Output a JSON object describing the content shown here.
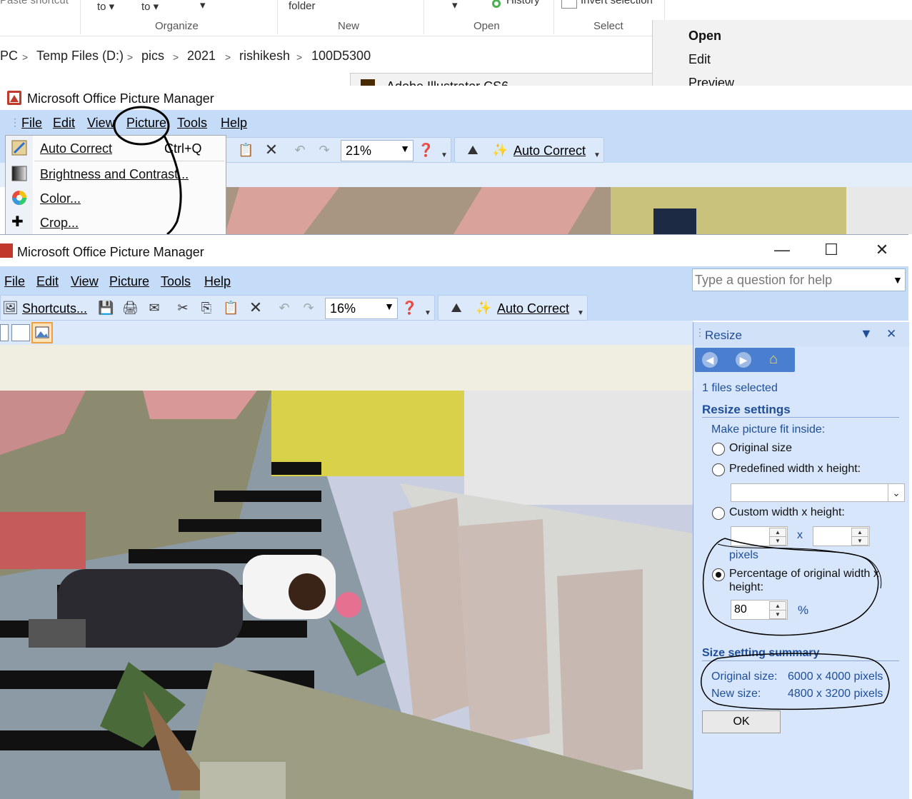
{
  "explorer": {
    "paste_shortcut": "Paste shortcut",
    "move_to": "to",
    "copy_to": "to",
    "folder": "folder",
    "history": "History",
    "invert_selection": "Invert selection",
    "groups": [
      "Organize",
      "New",
      "Open",
      "Select"
    ],
    "breadcrumb": [
      "PC",
      "Temp Files (D:)",
      "pics",
      "2021",
      "rishikesh",
      "100D5300"
    ],
    "illustrator_text": "Adobe Illustrator CS6"
  },
  "context_menu": {
    "items": [
      "Open",
      "Edit",
      "Preview"
    ]
  },
  "back_window": {
    "title": "Microsoft Office Picture Manager",
    "menu": [
      "File",
      "Edit",
      "View",
      "Picture",
      "Tools",
      "Help"
    ],
    "zoom": "21%",
    "auto_correct": "Auto Correct",
    "picture_menu": [
      {
        "label": "Auto Correct",
        "shortcut": "Ctrl+Q"
      },
      {
        "label": "Brightness and Contrast...",
        "shortcut": ""
      },
      {
        "label": "Color...",
        "shortcut": ""
      },
      {
        "label": "Crop...",
        "shortcut": ""
      }
    ]
  },
  "front_window": {
    "title": "Microsoft Office Picture Manager",
    "menu": [
      "File",
      "Edit",
      "View",
      "Picture",
      "Tools",
      "Help"
    ],
    "help_placeholder": "Type a question for help",
    "shortcuts": "Shortcuts...",
    "zoom": "16%",
    "auto_correct": "Auto Correct"
  },
  "resize_pane": {
    "title": "Resize",
    "files_selected": "1 files selected",
    "settings_heading": "Resize settings",
    "fit_inside": "Make picture fit inside:",
    "option_original": "Original size",
    "option_predefined": "Predefined width x height:",
    "option_custom": "Custom width x height:",
    "x_label": "x",
    "pixels_label": "pixels",
    "option_percentage_line1": "Percentage of original width x",
    "option_percentage_line2": "height:",
    "percentage_value": "80",
    "percent_sign": "%",
    "selected_option": "percentage",
    "summary_heading": "Size setting summary",
    "original_label": "Original size:",
    "original_value": "6000 x 4000 pixels",
    "new_label": "New size:",
    "new_value": "4800 x 3200 pixels",
    "ok": "OK"
  },
  "colors": {
    "menubar": "#c5dcf8",
    "pane": "#d7e6fa",
    "pane_text": "#1f4e9a"
  }
}
